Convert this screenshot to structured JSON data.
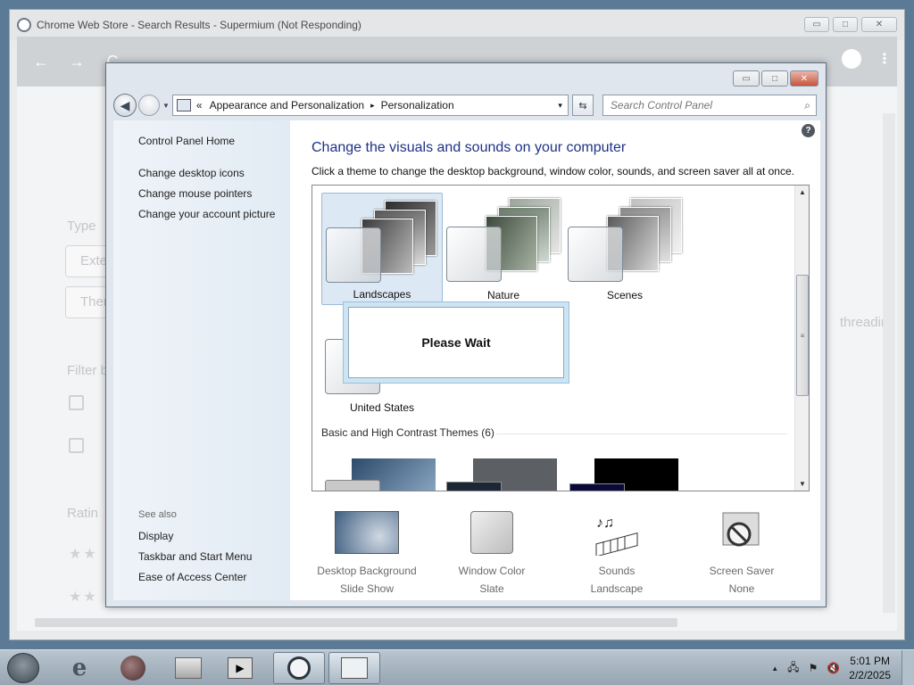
{
  "chrome": {
    "title": "Chrome Web Store - Search Results - Supermium (Not Responding)",
    "caption_min": "▭",
    "caption_max": "□",
    "caption_close": "✕",
    "nav_back": "←",
    "nav_forward": "→",
    "nav_reload": "C",
    "menu": "⋮",
    "ghost_texts": [
      "Type",
      "Exte",
      "Them",
      "Filter b",
      "Ratin",
      "threadin"
    ]
  },
  "control_panel": {
    "caption_min": "▭",
    "caption_max": "□",
    "caption_close": "✕",
    "breadcrumb_prefix": "«",
    "breadcrumb": [
      "Appearance and Personalization",
      "Personalization"
    ],
    "breadcrumb_sep": "▸",
    "address_dropdown": "▾",
    "refresh": "⇆",
    "search_placeholder": "Search Control Panel",
    "search_icon": "⌕",
    "help": "?",
    "left_nav": {
      "home": "Control Panel Home",
      "links": [
        "Change desktop icons",
        "Change mouse pointers",
        "Change your account picture"
      ],
      "see_also_label": "See also",
      "see_also": [
        "Display",
        "Taskbar and Start Menu",
        "Ease of Access Center"
      ]
    },
    "heading": "Change the visuals and sounds on your computer",
    "subheading": "Click a theme to change the desktop background, window color, sounds, and screen saver all at once.",
    "themes": [
      {
        "label": "Landscapes",
        "selected": true
      },
      {
        "label": "Nature",
        "selected": false
      },
      {
        "label": "Scenes",
        "selected": false
      },
      {
        "label": "United States",
        "selected": false
      }
    ],
    "basic_group_label": "Basic and High Contrast Themes (6)",
    "scroll_up": "▲",
    "scroll_down": "▼",
    "scroll_grip": "≡",
    "wait_text": "Please Wait",
    "bottom_items": [
      {
        "title": "Desktop Background",
        "value": "Slide Show",
        "icon": "desktop-background-icon"
      },
      {
        "title": "Window Color",
        "value": "Slate",
        "icon": "window-color-icon"
      },
      {
        "title": "Sounds",
        "value": "Landscape",
        "icon": "sounds-icon"
      },
      {
        "title": "Screen Saver",
        "value": "None",
        "icon": "screen-saver-icon"
      }
    ]
  },
  "taskbar": {
    "items": [
      "internet-explorer-icon",
      "browser-icon",
      "file-explorer-icon",
      "media-player-icon",
      "supermium-icon",
      "control-panel-icon"
    ],
    "time": "5:01 PM",
    "date": "2/2/2025",
    "tray_up": "▲",
    "tray_network": "🖧",
    "tray_flag": "⚑",
    "tray_volume": "🔇"
  }
}
